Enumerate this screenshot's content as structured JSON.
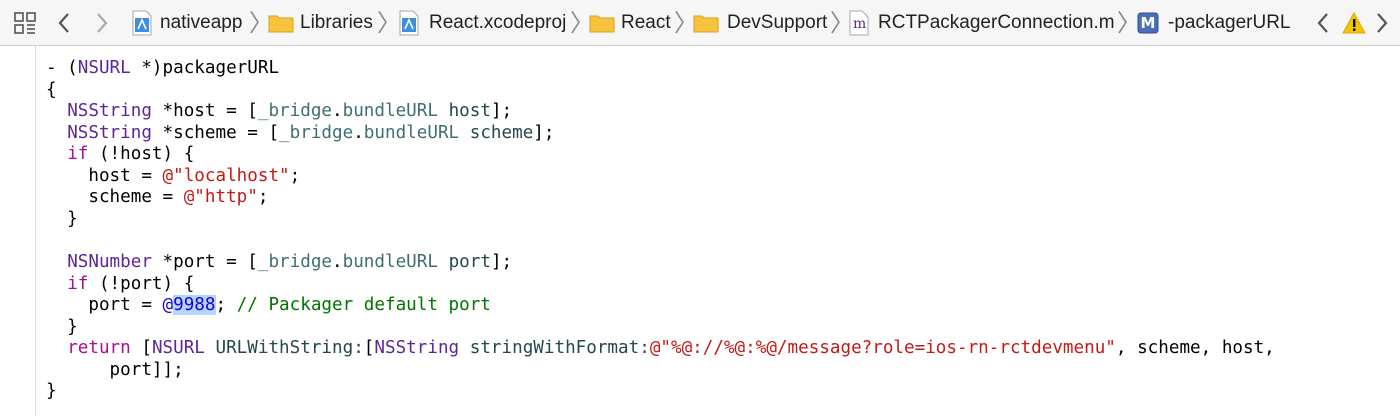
{
  "jump_bar": {
    "breadcrumbs": [
      {
        "label": "nativeapp",
        "icon": "xcode-project-icon"
      },
      {
        "label": "Libraries",
        "icon": "folder-icon"
      },
      {
        "label": "React.xcodeproj",
        "icon": "xcode-project-icon"
      },
      {
        "label": "React",
        "icon": "folder-icon"
      },
      {
        "label": "DevSupport",
        "icon": "folder-icon"
      },
      {
        "label": "RCTPackagerConnection.m",
        "icon": "objc-source-file-icon",
        "icon_letter": "m"
      },
      {
        "label": "-packagerURL",
        "icon": "method-icon",
        "icon_letter": "M"
      }
    ],
    "separator": "〉"
  },
  "colors": {
    "keyword": "#aa0d91",
    "class_name": "#5c2699",
    "property": "#3f6e74",
    "method": "#26474b",
    "string": "#c41a16",
    "number": "#1c00cf",
    "comment": "#007400",
    "selection": "#b4d5fe",
    "folder": "#f7c33c",
    "warning": "#f5c400"
  },
  "code": {
    "lines": [
      [
        {
          "t": "- ("
        },
        {
          "t": "NSURL",
          "c": "cls"
        },
        {
          "t": " *)packagerURL"
        }
      ],
      [
        {
          "t": "{"
        }
      ],
      [
        {
          "t": "  "
        },
        {
          "t": "NSString",
          "c": "cls"
        },
        {
          "t": " *host = ["
        },
        {
          "t": "_bridge",
          "c": "prop"
        },
        {
          "t": "."
        },
        {
          "t": "bundleURL",
          "c": "prop"
        },
        {
          "t": " "
        },
        {
          "t": "host",
          "c": "meth"
        },
        {
          "t": "];"
        }
      ],
      [
        {
          "t": "  "
        },
        {
          "t": "NSString",
          "c": "cls"
        },
        {
          "t": " *scheme = ["
        },
        {
          "t": "_bridge",
          "c": "prop"
        },
        {
          "t": "."
        },
        {
          "t": "bundleURL",
          "c": "prop"
        },
        {
          "t": " "
        },
        {
          "t": "scheme",
          "c": "meth"
        },
        {
          "t": "];"
        }
      ],
      [
        {
          "t": "  "
        },
        {
          "t": "if",
          "c": "kw"
        },
        {
          "t": " (!host) {"
        }
      ],
      [
        {
          "t": "    host = "
        },
        {
          "t": "@\"localhost\"",
          "c": "str"
        },
        {
          "t": ";"
        }
      ],
      [
        {
          "t": "    scheme = "
        },
        {
          "t": "@\"http\"",
          "c": "str"
        },
        {
          "t": ";"
        }
      ],
      [
        {
          "t": "  }"
        }
      ],
      [],
      [
        {
          "t": "  "
        },
        {
          "t": "NSNumber",
          "c": "cls"
        },
        {
          "t": " *port = ["
        },
        {
          "t": "_bridge",
          "c": "prop"
        },
        {
          "t": "."
        },
        {
          "t": "bundleURL",
          "c": "prop"
        },
        {
          "t": " "
        },
        {
          "t": "port",
          "c": "meth"
        },
        {
          "t": "];"
        }
      ],
      [
        {
          "t": "  "
        },
        {
          "t": "if",
          "c": "kw"
        },
        {
          "t": " (!port) {"
        }
      ],
      [
        {
          "t": "    port = "
        },
        {
          "t": "@",
          "c": "num"
        },
        {
          "t": "9988",
          "c": "num sel"
        },
        {
          "t": "; "
        },
        {
          "t": "// Packager default port",
          "c": "cmt"
        }
      ],
      [
        {
          "t": "  }"
        }
      ],
      [
        {
          "t": "  "
        },
        {
          "t": "return",
          "c": "kw"
        },
        {
          "t": " ["
        },
        {
          "t": "NSURL",
          "c": "cls"
        },
        {
          "t": " "
        },
        {
          "t": "URLWithString:",
          "c": "meth"
        },
        {
          "t": "["
        },
        {
          "t": "NSString",
          "c": "cls"
        },
        {
          "t": " "
        },
        {
          "t": "stringWithFormat:",
          "c": "meth"
        },
        {
          "t": "@\"%@://%@:%@/message?role=ios-rn-rctdevmenu\"",
          "c": "str"
        },
        {
          "t": ", scheme, host,"
        }
      ],
      [
        {
          "t": "      port]];"
        }
      ],
      [
        {
          "t": "}"
        }
      ]
    ]
  }
}
